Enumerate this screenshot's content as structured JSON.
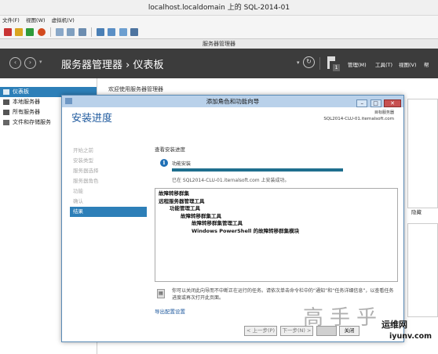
{
  "vm": {
    "title": "localhost.localdomain 上的 SQL-2014-01",
    "menu": [
      "文件(F)",
      "视图(W)",
      "虚拟机(V)"
    ]
  },
  "server_manager": {
    "window_title": "服务器管理器",
    "breadcrumb": "服务器管理器 › 仪表板",
    "notifications_count": "1",
    "header_menu": [
      "管理(M)",
      "工具(T)",
      "视图(V)",
      "帮"
    ],
    "welcome": "欢迎使用服务器管理器",
    "sidebar": [
      {
        "label": "仪表板",
        "selected": true
      },
      {
        "label": "本地服务器",
        "selected": false
      },
      {
        "label": "所有服务器",
        "selected": false
      },
      {
        "label": "文件和存储服务",
        "selected": false
      }
    ],
    "bg_text": {
      "hide": "隐藏"
    }
  },
  "wizard": {
    "title": "添加角色和功能向导",
    "heading": "安装进度",
    "destination_label": "目标服务器",
    "destination_server": "SQL2014-CLU-01.iternalsoft.com",
    "steps": [
      {
        "label": "开始之前",
        "current": false
      },
      {
        "label": "安装类型",
        "current": false
      },
      {
        "label": "服务器选择",
        "current": false
      },
      {
        "label": "服务器角色",
        "current": false
      },
      {
        "label": "功能",
        "current": false
      },
      {
        "label": "确认",
        "current": false
      },
      {
        "label": "结果",
        "current": true
      }
    ],
    "view_progress_label": "查看安装进度",
    "feature_install_label": "功能安装",
    "progress": 1.0,
    "success_message": "已在 SQL2014-CLU-01.iternalsoft.com 上安装成功。",
    "results": [
      {
        "text": "故障转移群集",
        "level": 0
      },
      {
        "text": "远程服务器管理工具",
        "level": 0
      },
      {
        "text": "功能管理工具",
        "level": 1
      },
      {
        "text": "故障转移群集工具",
        "level": 2
      },
      {
        "text": "故障转移群集管理工具",
        "level": 3
      },
      {
        "text": "Windows PowerShell 的故障转移群集模块",
        "level": 3
      }
    ],
    "tip": "你可以关闭此向导而不中断正在运行的任务。请依次单击命令栏中的“通知”和“任务详细信息”，以查看任务进度或再次打开此页面。",
    "export_link": "导出配置设置",
    "buttons": {
      "prev": "< 上一步(P)",
      "next": "下一步(N) >",
      "close": "关闭"
    }
  },
  "watermark": {
    "big": "高手乎",
    "net": "运维网",
    "url": "iyunv.com"
  },
  "colors": {
    "accent": "#2d7fb8",
    "progress": "#1f6f8e",
    "dark_header": "#3c3c3c"
  }
}
